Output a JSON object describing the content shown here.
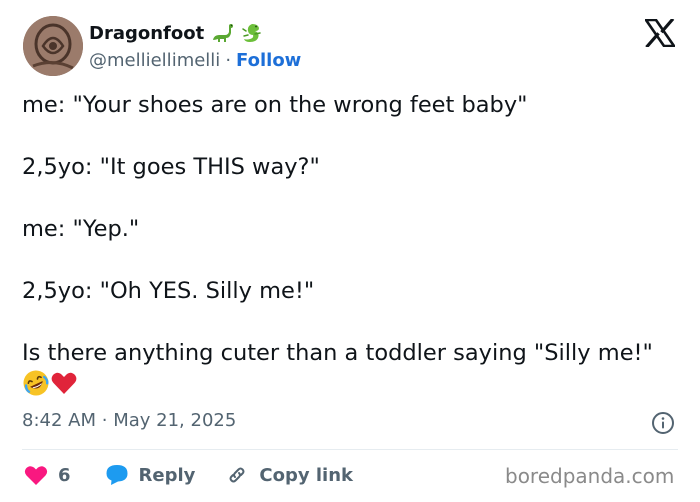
{
  "author": {
    "display_name": "Dragonfoot",
    "name_emojis": [
      "sauropod-emoji",
      "lizard-emoji"
    ],
    "handle": "@melliellimelli",
    "separator": "·",
    "follow_label": "Follow",
    "avatar": "avatar-photo"
  },
  "platform_icon": "x-logo-icon",
  "tweet": {
    "lines": [
      "me: \"Your shoes are on the wrong feet baby\"",
      "2,5yo: \"It goes THIS way?\"",
      "me: \"Yep.\"",
      "2,5yo: \"Oh YES. Silly me!\"",
      "Is there anything cuter than a toddler saying \"Silly me!\""
    ],
    "trailing_emojis": [
      "rolling-laughing-emoji",
      "red-heart-emoji"
    ]
  },
  "meta": {
    "time": "8:42 AM",
    "separator": "·",
    "date": "May 21, 2025",
    "info_icon": "info-icon"
  },
  "actions": {
    "likes_count": "6",
    "reply_label": "Reply",
    "copy_link_label": "Copy link"
  },
  "watermark": "boredpanda.com",
  "colors": {
    "accent": "#1d6fd8",
    "muted": "#536471",
    "text": "#0f1419",
    "heart": "#f91880",
    "reply_bubble": "#1d9bf0"
  }
}
